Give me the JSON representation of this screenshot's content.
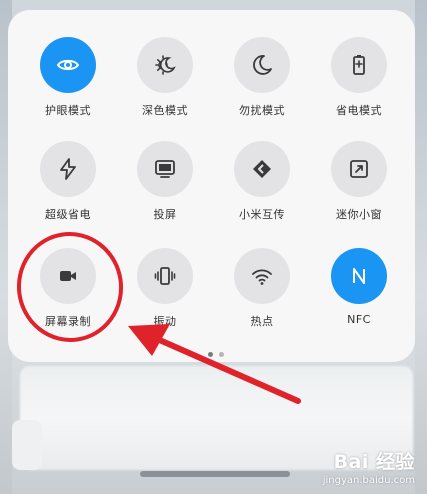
{
  "tiles": [
    {
      "label": "护眼模式",
      "icon": "eye-icon",
      "active": true
    },
    {
      "label": "深色模式",
      "icon": "sun-moon-icon",
      "active": false
    },
    {
      "label": "勿扰模式",
      "icon": "moon-icon",
      "active": false
    },
    {
      "label": "省电模式",
      "icon": "battery-icon",
      "active": false
    },
    {
      "label": "超级省电",
      "icon": "lightning-icon",
      "active": false
    },
    {
      "label": "投屏",
      "icon": "screen-cast-icon",
      "active": false
    },
    {
      "label": "小米互传",
      "icon": "mi-share-icon",
      "active": false
    },
    {
      "label": "迷你小窗",
      "icon": "mini-window-icon",
      "active": false
    },
    {
      "label": "屏幕录制",
      "icon": "video-camera-icon",
      "active": false
    },
    {
      "label": "振动",
      "icon": "vibrate-icon",
      "active": false
    },
    {
      "label": "热点",
      "icon": "hotspot-icon",
      "active": false
    },
    {
      "label": "NFC",
      "icon": "nfc-icon",
      "active": true
    }
  ],
  "pagination": {
    "pages": 2,
    "current": 1
  },
  "watermark": {
    "main": "Bai 经验",
    "sub": "jingyan.baidu.com"
  },
  "colors": {
    "accent": "#1b95f3",
    "annotation": "#e0222a"
  }
}
